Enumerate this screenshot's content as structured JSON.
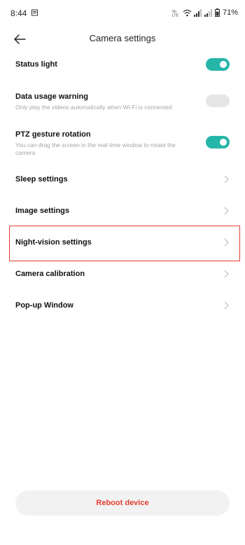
{
  "status_bar": {
    "time": "8:44",
    "battery": "71%"
  },
  "header": {
    "title": "Camera settings"
  },
  "settings": {
    "status_light": {
      "title": "Status light",
      "enabled": true
    },
    "data_usage_warning": {
      "title": "Data usage warning",
      "description": "Only play the videos automatically when Wi-Fi is connected",
      "enabled": false
    },
    "ptz_gesture_rotation": {
      "title": "PTZ gesture rotation",
      "description": "You can drag the screen in the real-time window to rotate the camera",
      "enabled": true
    },
    "sleep_settings": {
      "title": "Sleep settings"
    },
    "image_settings": {
      "title": "Image settings"
    },
    "night_vision_settings": {
      "title": "Night-vision settings"
    },
    "camera_calibration": {
      "title": "Camera calibration"
    },
    "popup_window": {
      "title": "Pop-up Window"
    }
  },
  "footer": {
    "reboot_label": "Reboot device"
  },
  "colors": {
    "accent": "#26b5a9",
    "danger": "#e53e2f",
    "highlight": "#e2412e",
    "muted_text": "#a5a5a5"
  }
}
